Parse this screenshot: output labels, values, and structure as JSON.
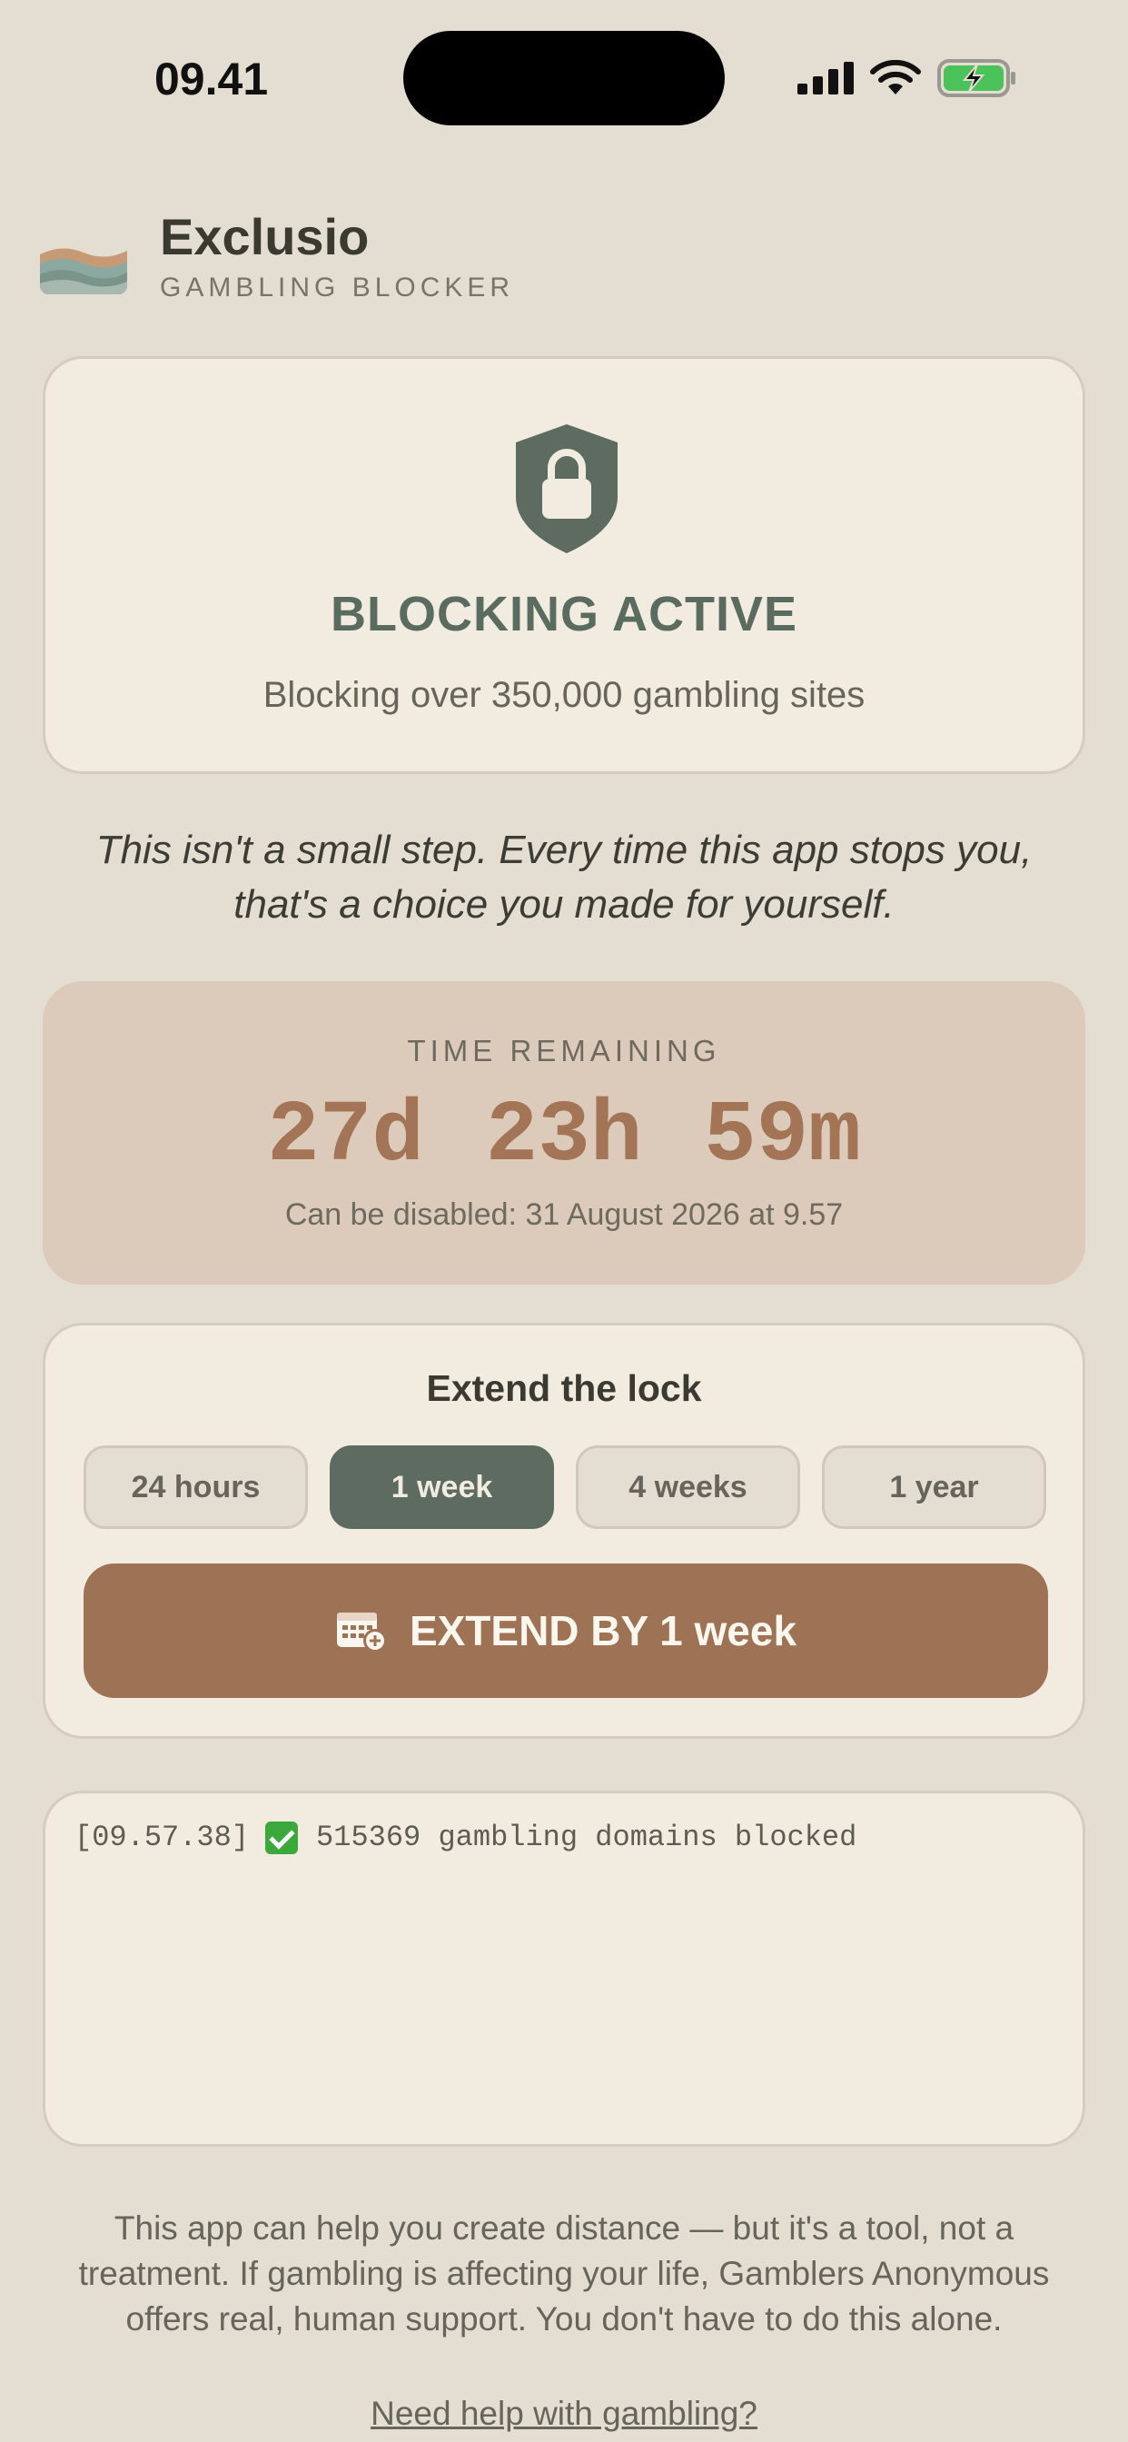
{
  "status_bar": {
    "time": "09.41"
  },
  "header": {
    "title": "Exclusio",
    "subtitle": "GAMBLING BLOCKER"
  },
  "status_card": {
    "icon": "shield-lock-icon",
    "title": "BLOCKING ACTIVE",
    "subtitle": "Blocking over 350,000 gambling sites"
  },
  "quote": "This isn't a small step. Every time this app stops you, that's a choice you made for yourself.",
  "time_remaining": {
    "label": "TIME REMAINING",
    "value": "27d 23h 59m",
    "note": "Can be disabled: 31 August 2026 at 9.57"
  },
  "extend": {
    "title": "Extend the lock",
    "options": [
      "24 hours",
      "1 week",
      "4 weeks",
      "1 year"
    ],
    "selected": "1 week",
    "button_label": "EXTEND BY 1 week",
    "button_icon": "calendar-add-icon"
  },
  "log": {
    "timestamp": "[09.57.38]",
    "message": "515369 gambling domains blocked"
  },
  "disclaimer": "This app can help you create distance — but it's a tool, not a treatment. If gambling is affecting your life, Gamblers Anonymous offers real, human support. You don't have to do this alone.",
  "help_link": "Need help with gambling?",
  "colors": {
    "background": "#e3ddd2",
    "card": "#f1ebe0",
    "accent_green": "#5d6b60",
    "accent_brown": "#9d7255",
    "time_card": "#dccbbb"
  }
}
